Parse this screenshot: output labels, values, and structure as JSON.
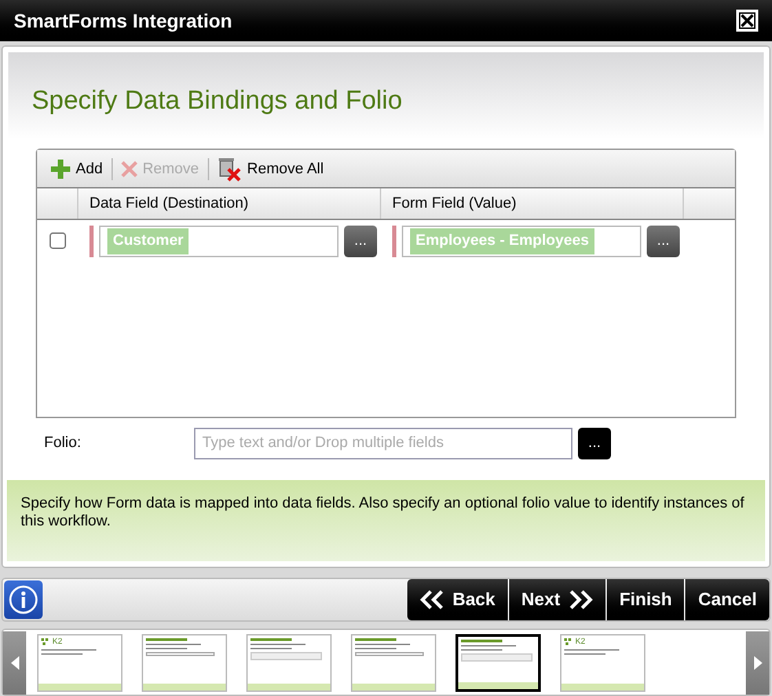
{
  "window": {
    "title": "SmartForms Integration"
  },
  "page_title": "Specify Data Bindings and Folio",
  "toolbar": [
    {
      "kind": "add",
      "label": "Add",
      "disabled": false
    },
    {
      "kind": "remove",
      "label": "Remove",
      "disabled": true
    },
    {
      "kind": "remove_all",
      "label": "Remove All",
      "disabled": false
    }
  ],
  "table": {
    "columns": [
      "Data Field (Destination)",
      "Form Field (Value)"
    ],
    "rows": [
      {
        "checked": false,
        "destination": "Customer",
        "value": "Employees - Employees",
        "browse": "..."
      }
    ]
  },
  "folio": {
    "label": "Folio:",
    "placeholder": "Type text and/or Drop multiple fields",
    "browse": "..."
  },
  "help": "Specify how Form data is mapped into data fields. Also specify an optional folio value to identify instances of this workflow.",
  "nav_buttons": [
    {
      "kind": "back",
      "label": "Back"
    },
    {
      "kind": "next",
      "label": "Next"
    },
    {
      "kind": "plain",
      "label": "Finish"
    },
    {
      "kind": "plain",
      "label": "Cancel"
    }
  ],
  "thumbnails": [
    {
      "kind": "intro",
      "logo": "K2",
      "selected": false
    },
    {
      "kind": "form",
      "selected": false
    },
    {
      "kind": "list",
      "selected": false
    },
    {
      "kind": "form",
      "selected": false
    },
    {
      "kind": "list",
      "selected": true
    },
    {
      "kind": "intro",
      "logo": "K2",
      "selected": false
    }
  ]
}
